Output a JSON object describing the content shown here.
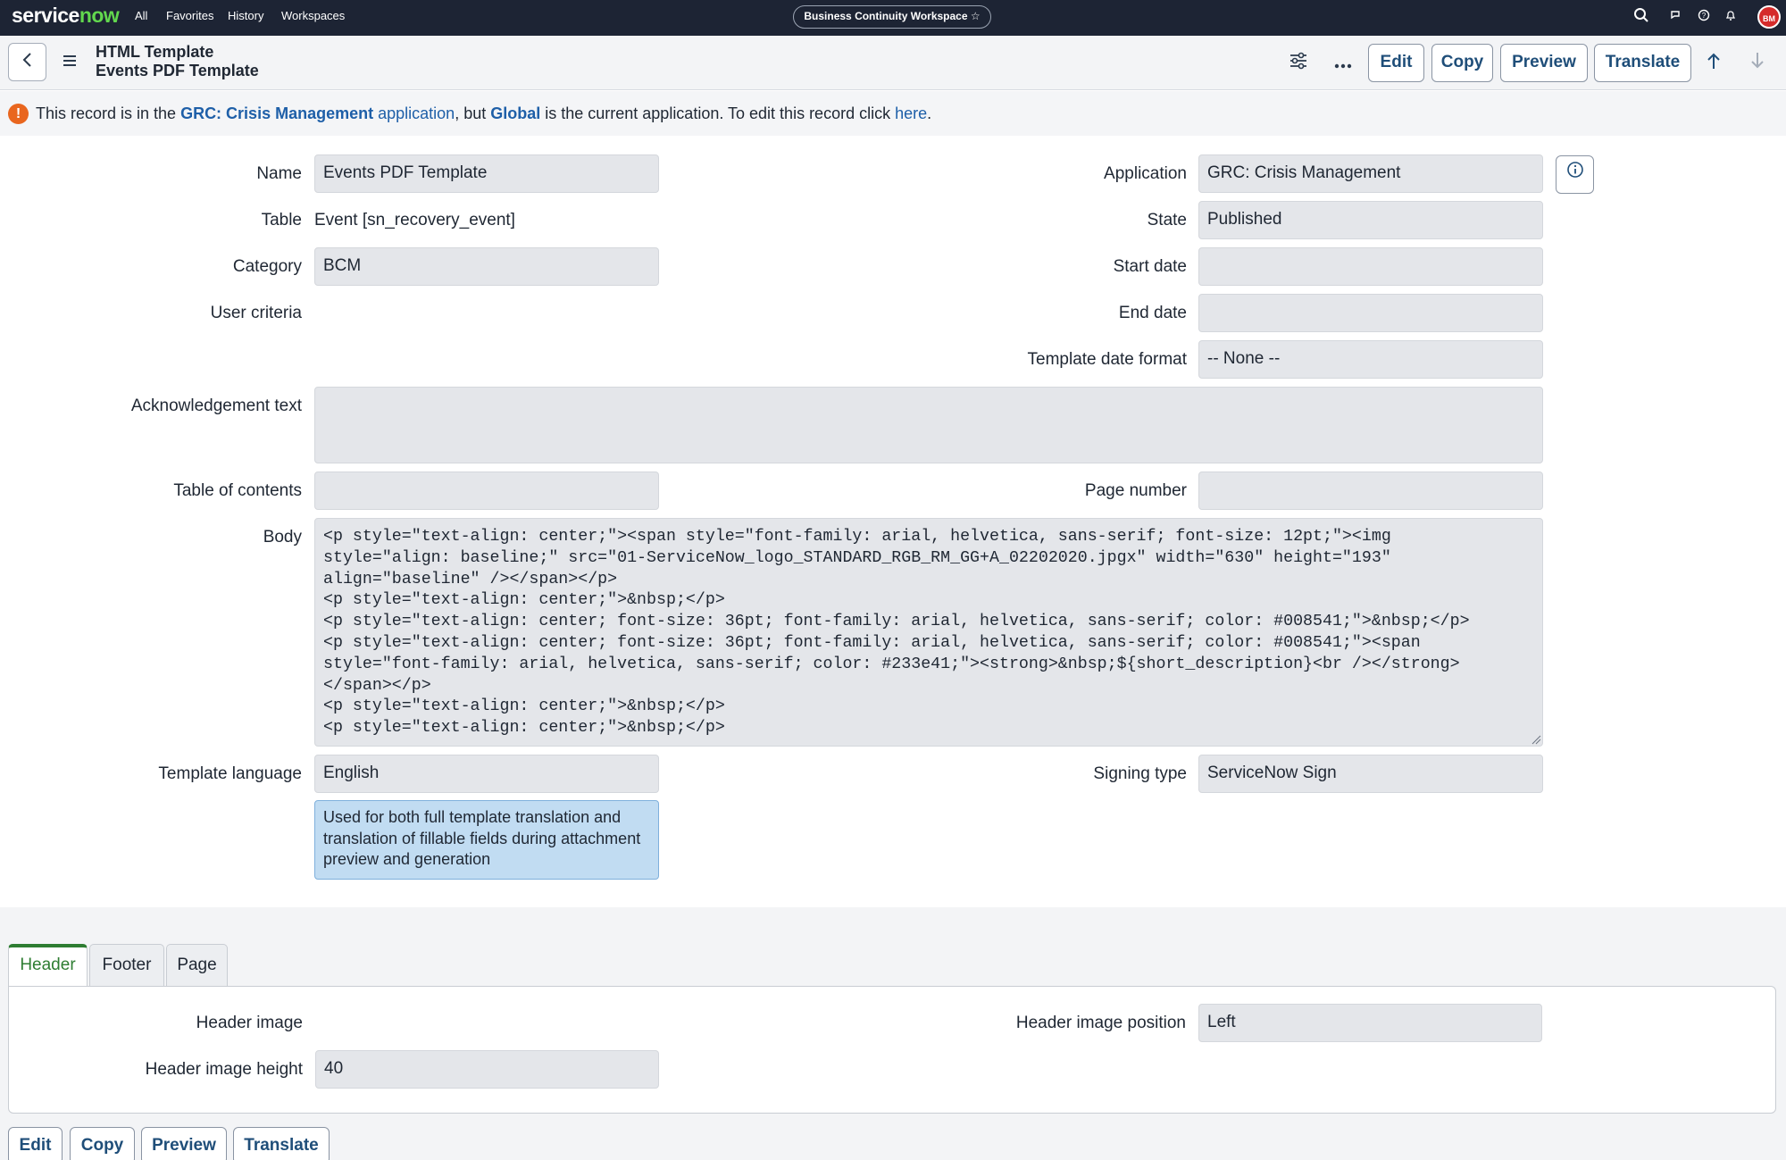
{
  "topnav": {
    "logo_main": "service",
    "logo_accent": "now",
    "links": [
      "All",
      "Favorites",
      "History",
      "Workspaces"
    ],
    "workspace_pill": "Business Continuity Workspace ☆",
    "avatar_initials": "BM"
  },
  "header": {
    "title": "HTML Template",
    "subtitle": "Events PDF Template",
    "buttons": {
      "edit": "Edit",
      "copy": "Copy",
      "preview": "Preview",
      "translate": "Translate"
    }
  },
  "banner": {
    "p1": "This record is in the ",
    "app_name": "GRC: Crisis Management",
    "p2": " application",
    "p3": ", but ",
    "global": "Global",
    "p4": " is the current application. To edit this record click ",
    "here": "here",
    "p5": "."
  },
  "form": {
    "name_label": "Name",
    "name_value": "Events PDF Template",
    "table_label": "Table",
    "table_value": "Event [sn_recovery_event]",
    "category_label": "Category",
    "category_value": "BCM",
    "user_criteria_label": "User criteria",
    "application_label": "Application",
    "application_value": "GRC: Crisis Management",
    "state_label": "State",
    "state_value": "Published",
    "start_date_label": "Start date",
    "start_date_value": "",
    "end_date_label": "End date",
    "end_date_value": "",
    "date_format_label": "Template date format",
    "date_format_value": "-- None --",
    "ack_label": "Acknowledgement text",
    "ack_value": "",
    "toc_label": "Table of contents",
    "toc_value": "",
    "page_number_label": "Page number",
    "page_number_value": "",
    "body_label": "Body",
    "body_lines": [
      "<p style=\"text-align: center;\"><span style=\"font-family: arial, helvetica, sans-serif; font-size: 12pt;\"><img",
      "style=\"align: baseline;\" src=\"01-ServiceNow_logo_STANDARD_RGB_RM_GG+A_02202020.jpgx\" width=\"630\" height=\"193\"",
      "align=\"baseline\" /></span></p>",
      "<p style=\"text-align: center;\">&nbsp;</p>",
      "<p style=\"text-align: center; font-size: 36pt; font-family: arial, helvetica, sans-serif; color: #008541;\">&nbsp;</p>",
      "<p style=\"text-align: center; font-size: 36pt; font-family: arial, helvetica, sans-serif; color: #008541;\"><span",
      "style=\"font-family: arial, helvetica, sans-serif; color: #233e41;\"><strong>&nbsp;${short_description}<br /></strong>",
      "</span></p>",
      "<p style=\"text-align: center;\">&nbsp;</p>",
      "<p style=\"text-align: center;\">&nbsp;</p>"
    ],
    "template_language_label": "Template language",
    "template_language_value": "English",
    "template_language_hint": "Used for both full template translation and translation of fillable fields during attachment preview and generation",
    "signing_type_label": "Signing type",
    "signing_type_value": "ServiceNow Sign"
  },
  "tabs": {
    "items": [
      "Header",
      "Footer",
      "Page"
    ],
    "header_image_label": "Header image",
    "header_image_position_label": "Header image position",
    "header_image_position_value": "Left",
    "header_image_height_label": "Header image height",
    "header_image_height_value": "40"
  },
  "bottom_buttons": {
    "edit": "Edit",
    "copy": "Copy",
    "preview": "Preview",
    "translate": "Translate"
  }
}
